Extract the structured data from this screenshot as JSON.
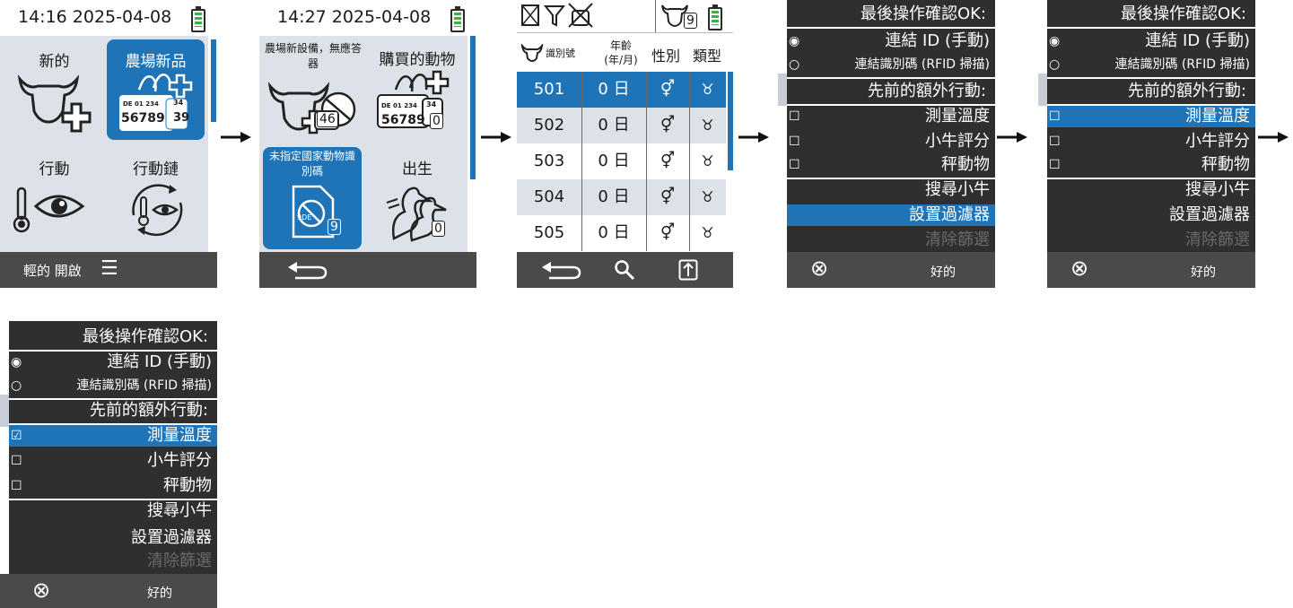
{
  "s1": {
    "time": "14:16 2025-04-08",
    "tiles": [
      "新的",
      "農場新品",
      "行動",
      "行動鏈"
    ],
    "tag_line1": "DE 01 234",
    "tag_line2": "56789",
    "tag_back1": "34",
    "tag_back2": "39",
    "footer": "輕的 開啟"
  },
  "s2": {
    "time": "14:27 2025-04-08",
    "tiles": [
      "農場新設備，無應答器",
      "購買的動物",
      "未指定國家動物識別碼",
      "出生"
    ],
    "badges": [
      "46",
      "0",
      "9",
      "0"
    ],
    "tag_line1": "DE 01 234",
    "tag_line2": "56789",
    "tag_back1": "34",
    "circle_text": "9DE"
  },
  "s3": {
    "badge": "9",
    "headers": {
      "id": "識別號",
      "age": "年齡\n(年/月)",
      "sex": "性別",
      "type": "類型"
    },
    "rows": [
      {
        "id": "501",
        "age": "0 日"
      },
      {
        "id": "502",
        "age": "0 日"
      },
      {
        "id": "503",
        "age": "0 日"
      },
      {
        "id": "504",
        "age": "0 日"
      },
      {
        "id": "505",
        "age": "0 日"
      }
    ]
  },
  "menu": {
    "title": "最後操作確認OK:",
    "opt1": "連結 ID (手動)",
    "opt2": "連結識別碼 (RFID 掃描)",
    "section": "先前的額外行動:",
    "act1": "測量溫度",
    "act2": "小牛評分",
    "act3": "秤動物",
    "search": "搜尋小牛",
    "filter": "設置過濾器",
    "clear": "清除篩選",
    "ok": "好的"
  }
}
